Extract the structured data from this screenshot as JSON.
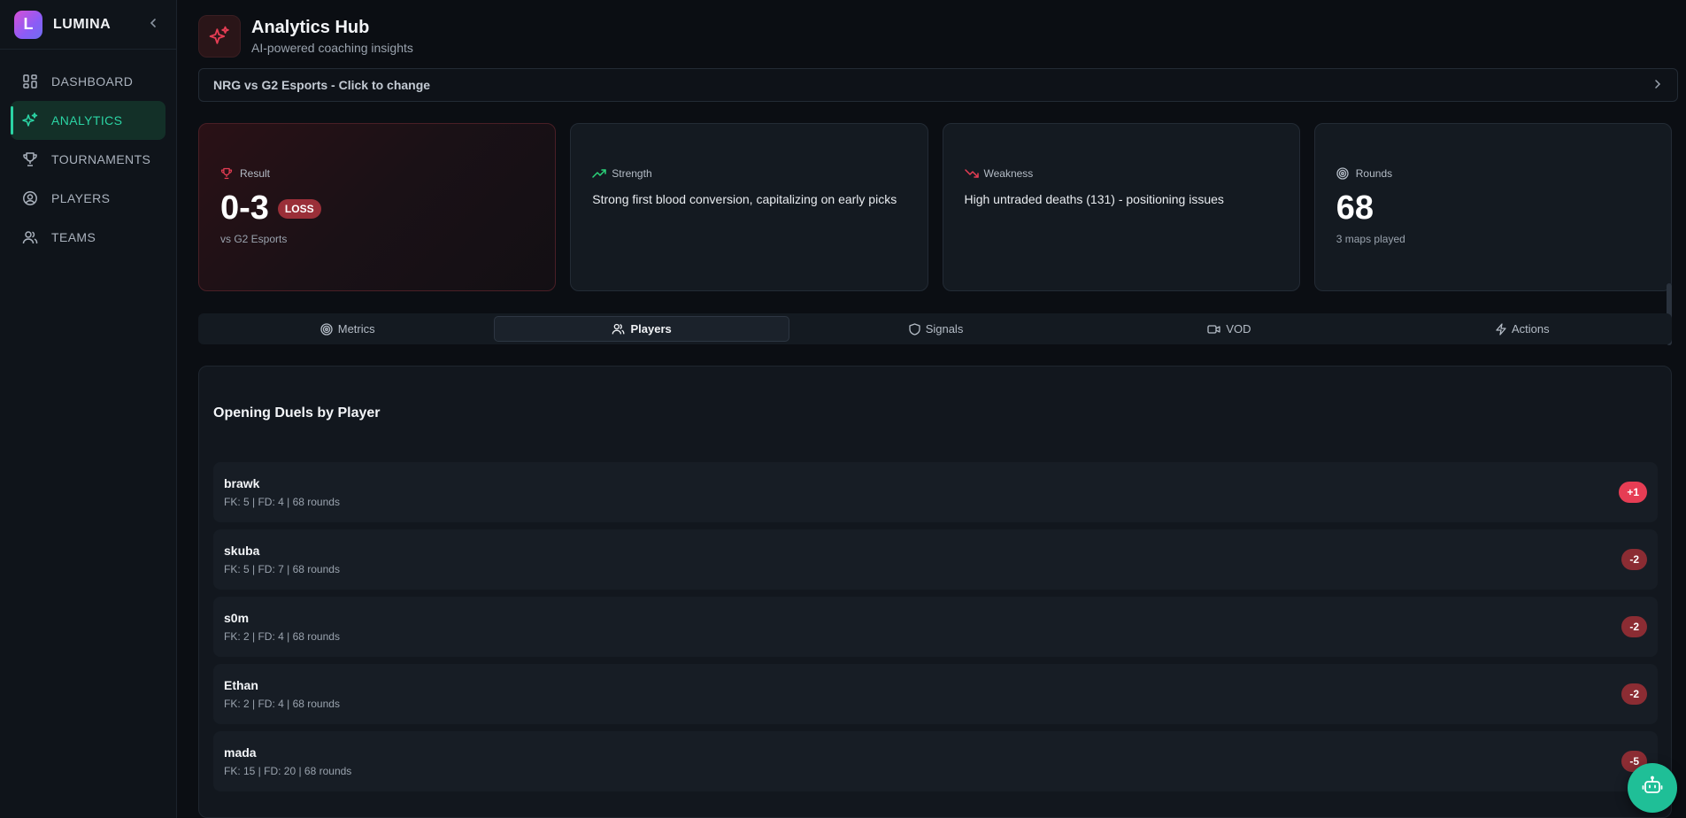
{
  "app": {
    "name": "LUMINA",
    "logo_letter": "L"
  },
  "sidebar": {
    "items": [
      {
        "label": "DASHBOARD",
        "icon": "dashboard-grid-icon",
        "active": false
      },
      {
        "label": "ANALYTICS",
        "icon": "sparkles-icon",
        "active": true
      },
      {
        "label": "TOURNAMENTS",
        "icon": "trophy-icon",
        "active": false
      },
      {
        "label": "PLAYERS",
        "icon": "user-circle-icon",
        "active": false
      },
      {
        "label": "TEAMS",
        "icon": "users-icon",
        "active": false
      }
    ]
  },
  "header": {
    "title": "Analytics Hub",
    "subtitle": "AI-powered coaching insights"
  },
  "match_selector": {
    "label": "NRG vs G2 Esports - Click to change"
  },
  "cards": {
    "result": {
      "label": "Result",
      "value": "0-3",
      "badge": "LOSS",
      "sub": "vs G2 Esports"
    },
    "strength": {
      "label": "Strength",
      "text": "Strong first blood conversion, capitalizing on early picks"
    },
    "weakness": {
      "label": "Weakness",
      "text": "High untraded deaths (131) - positioning issues"
    },
    "rounds": {
      "label": "Rounds",
      "value": "68",
      "sub": "3 maps played"
    }
  },
  "tabs": [
    {
      "label": "Metrics",
      "icon": "target-icon",
      "active": false
    },
    {
      "label": "Players",
      "icon": "users-icon",
      "active": true
    },
    {
      "label": "Signals",
      "icon": "shield-icon",
      "active": false
    },
    {
      "label": "VOD",
      "icon": "video-icon",
      "active": false
    },
    {
      "label": "Actions",
      "icon": "lightning-icon",
      "active": false
    }
  ],
  "panel": {
    "title": "Opening Duels by Player",
    "players": [
      {
        "name": "brawk",
        "stats": "FK: 5 | FD: 4 | 68 rounds",
        "diff": "+1"
      },
      {
        "name": "skuba",
        "stats": "FK: 5 | FD: 7 | 68 rounds",
        "diff": "-2"
      },
      {
        "name": "s0m",
        "stats": "FK: 2 | FD: 4 | 68 rounds",
        "diff": "-2"
      },
      {
        "name": "Ethan",
        "stats": "FK: 2 | FD: 4 | 68 rounds",
        "diff": "-2"
      },
      {
        "name": "mada",
        "stats": "FK: 15 | FD: 20 | 68 rounds",
        "diff": "-5"
      }
    ]
  },
  "colors": {
    "accent": "#2bd4a4",
    "danger": "#e63d54",
    "negative_badge": "#8b2c33",
    "fab": "#1fbf97"
  }
}
